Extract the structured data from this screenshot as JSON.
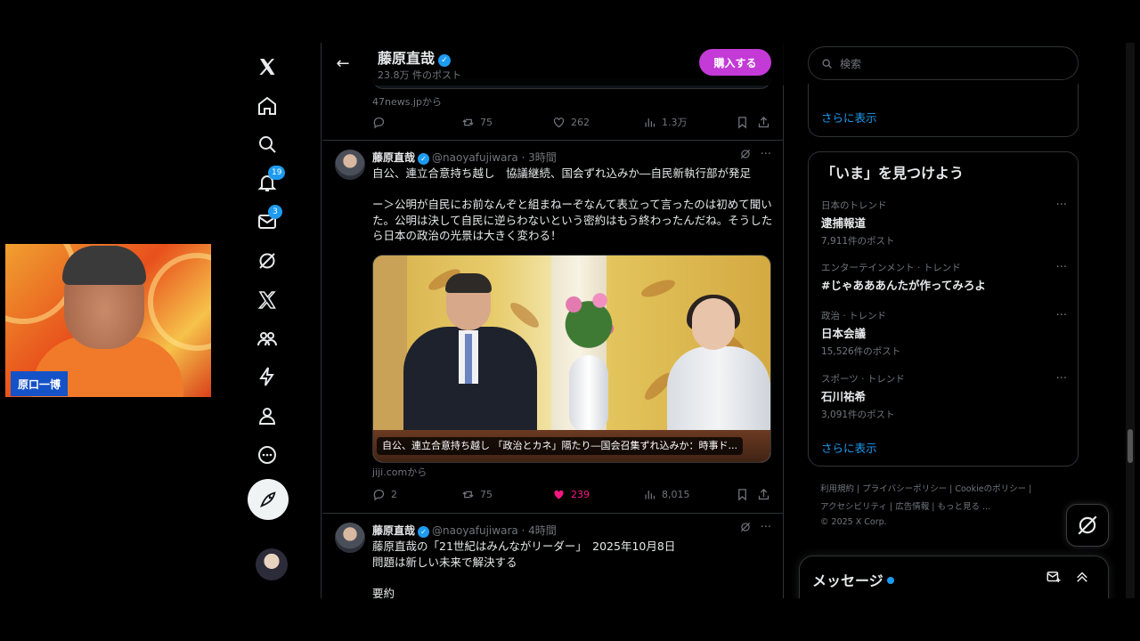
{
  "webcam": {
    "name": "原口一博"
  },
  "header": {
    "title": "藤原直哉",
    "subtitle": "23.8万 件のポスト",
    "buy_label": "購入する"
  },
  "prev_post": {
    "source": "47news.jpから",
    "retweets": "75",
    "likes": "262",
    "views": "1.3万"
  },
  "post1": {
    "name": "藤原直哉",
    "handle_time": "@naoyafujiwara · 3時間",
    "text": "自公、連立合意持ち越し　協議継続、国会ずれ込みか―自民新執行部が発足\n\nー＞公明が自民にお前なんぞと組まねーぞなんて表立って言ったのは初めて聞いた。公明は決して自民に逆らわないという密約はもう終わったんだね。そうしたら日本の政治の光景は大きく変わる！",
    "media_caption": "自公、連立合意持ち越し 「政治とカネ」隔たり―国会召集ずれ込みか：時事ド...",
    "source": "jiji.comから",
    "replies": "2",
    "retweets": "75",
    "likes": "239",
    "views": "8,015"
  },
  "post2": {
    "name": "藤原直哉",
    "handle_time": "@naoyafujiwara · 4時間",
    "text": "藤原直哉の「21世紀はみんながリーダー」　2025年10月8日\n問題は新しい未来で解決する\n\n要約"
  },
  "sidebar": {
    "search_placeholder": "検索",
    "show_more_1": "さらに表示",
    "explore_title": "「いま」を見つけよう",
    "trends": [
      {
        "category": "日本のトレンド",
        "title": "逮捕報道",
        "count": "7,911件のポスト"
      },
      {
        "category": "エンターテインメント · トレンド",
        "title": "#じゃあああんたが作ってみろよ",
        "count": ""
      },
      {
        "category": "政治 · トレンド",
        "title": "日本会議",
        "count": "15,526件のポスト"
      },
      {
        "category": "スポーツ · トレンド",
        "title": "石川祐希",
        "count": "3,091件のポスト"
      }
    ],
    "show_more_2": "さらに表示",
    "footer": {
      "terms": "利用規約",
      "privacy": "プライバシーポリシー",
      "cookie": "Cookieのポリシー",
      "accessibility": "アクセシビリティ",
      "ads": "広告情報",
      "more": "もっと見る ...",
      "copyright": "© 2025 X Corp."
    }
  },
  "nav": {
    "notifications_badge": "19",
    "messages_badge": "3"
  },
  "messages": {
    "title": "メッセージ"
  },
  "colors": {
    "accent": "#1d9bf0",
    "buy": "#c33ad7",
    "like": "#f91880"
  }
}
